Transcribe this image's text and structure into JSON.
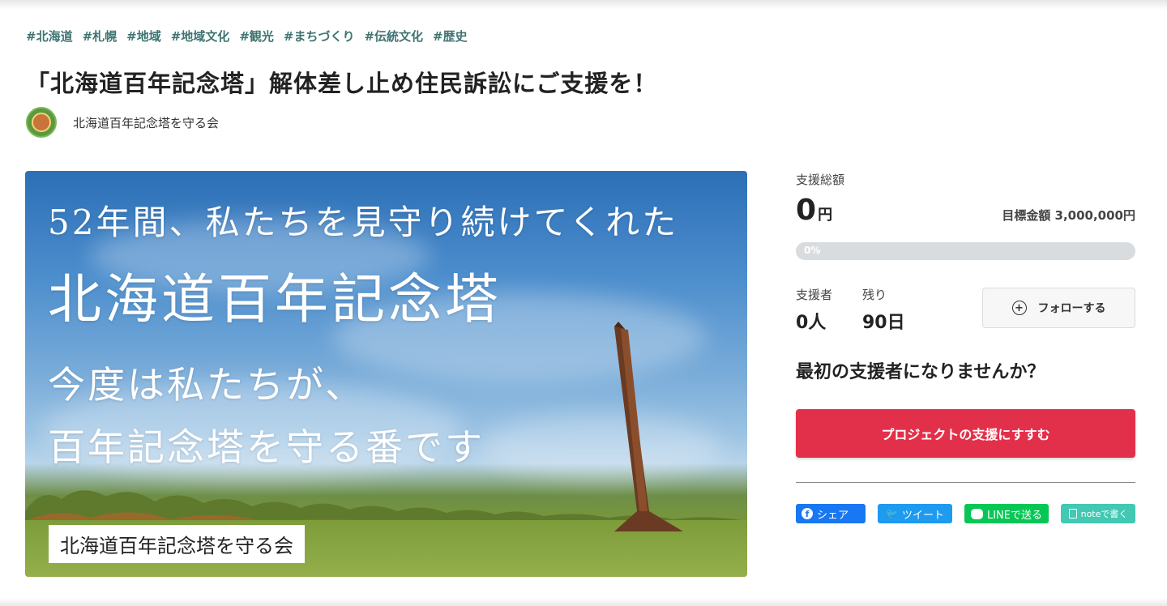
{
  "tags": [
    "#北海道",
    "#札幌",
    "#地域",
    "#地域文化",
    "#観光",
    "#まちづくり",
    "#伝統文化",
    "#歴史"
  ],
  "project": {
    "title": "「北海道百年記念塔」解体差し止め住民訴訟にご支援を！",
    "owner": "北海道百年記念塔を守る会"
  },
  "hero": {
    "line1": "52年間、私たちを見守り続けてくれた",
    "line2": "北海道百年記念塔",
    "line3": "今度は私たちが、",
    "line4": "百年記念塔を守る番です",
    "badge": "北海道百年記念塔を守る会"
  },
  "funding": {
    "total_label": "支援総額",
    "total_value": "0",
    "total_unit": "円",
    "goal": "目標金額 3,000,000円",
    "progress_text": "0%",
    "progress": 0,
    "supporters_label": "支援者",
    "supporters_value": "0人",
    "remaining_label": "残り",
    "remaining_value": "90日"
  },
  "follow_button": "フォローする",
  "cta_question": "最初の支援者になりませんか？",
  "cta_button": "プロジェクトの支援にすすむ",
  "share": {
    "facebook": "シェア",
    "twitter": "ツイート",
    "line": "LINEで送る",
    "note": "noteで書く"
  },
  "colors": {
    "tag": "#3f7472",
    "cta": "#e3304a",
    "facebook": "#1877f2",
    "twitter": "#1d9bf0",
    "line": "#06c755",
    "note": "#41c9b4"
  }
}
